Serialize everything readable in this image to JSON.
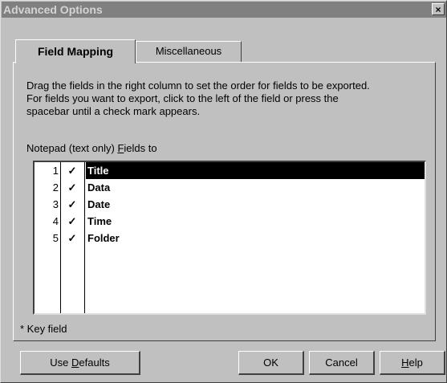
{
  "window": {
    "title": "Advanced Options",
    "close_label": "×"
  },
  "tabs": [
    {
      "label": "Field Mapping",
      "active": true
    },
    {
      "label": "Miscellaneous",
      "active": false
    }
  ],
  "description": [
    "Drag the fields in the right column to set the order for fields to be exported.",
    "For fields you want to export, click to the left of the field or press the",
    "spacebar until a check mark appears."
  ],
  "list_label": {
    "prefix": "Notepad (text only) ",
    "accel": "F",
    "rest": "ields to"
  },
  "fields": [
    {
      "num": "1",
      "check": "✓",
      "name": "Title",
      "selected": true
    },
    {
      "num": "2",
      "check": "✓",
      "name": "Data",
      "selected": false
    },
    {
      "num": "3",
      "check": "✓",
      "name": "Date",
      "selected": false
    },
    {
      "num": "4",
      "check": "✓",
      "name": "Time",
      "selected": false
    },
    {
      "num": "5",
      "check": "✓",
      "name": "Folder",
      "selected": false
    }
  ],
  "key_field_note": "* Key field",
  "buttons": {
    "use_defaults": {
      "prefix": "Use ",
      "accel": "D",
      "rest": "efaults"
    },
    "ok": "OK",
    "cancel": "Cancel",
    "help": {
      "accel": "H",
      "rest": "elp"
    }
  }
}
